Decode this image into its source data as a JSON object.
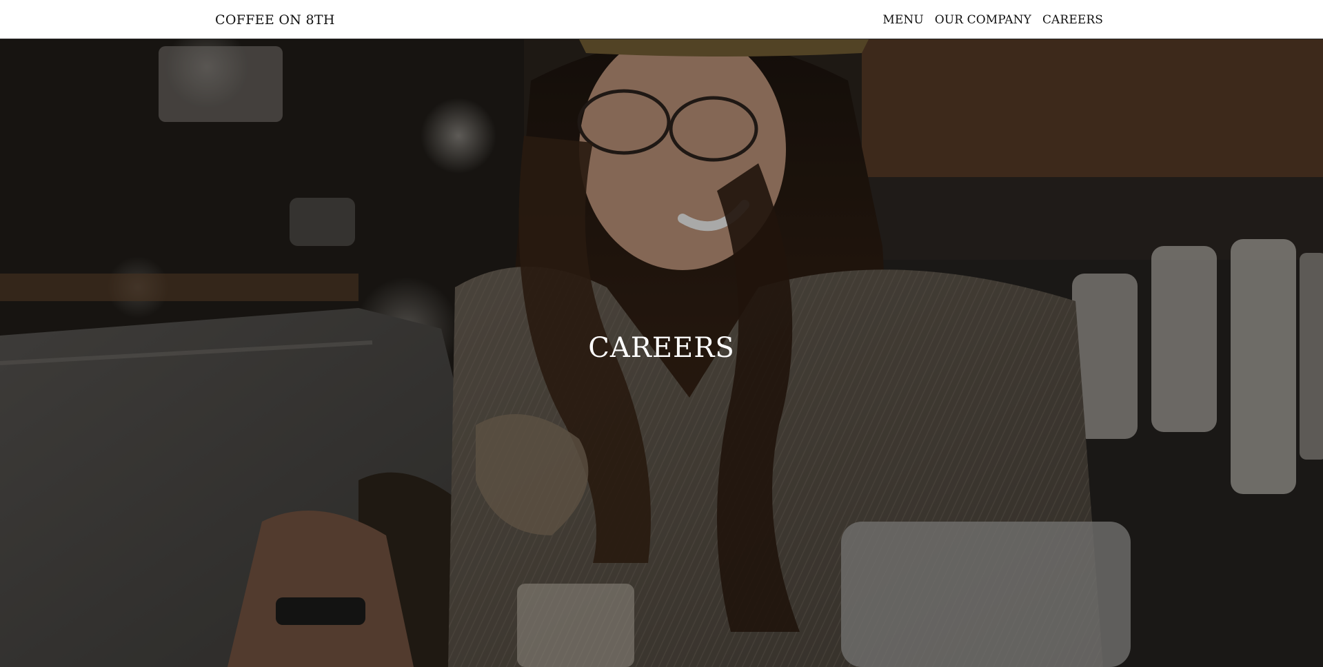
{
  "navbar": {
    "brand": "COFFEE ON 8TH",
    "links": [
      {
        "label": "MENU"
      },
      {
        "label": "OUR COMPANY"
      },
      {
        "label": "CAREERS"
      }
    ]
  },
  "hero": {
    "title": "CAREERS"
  }
}
